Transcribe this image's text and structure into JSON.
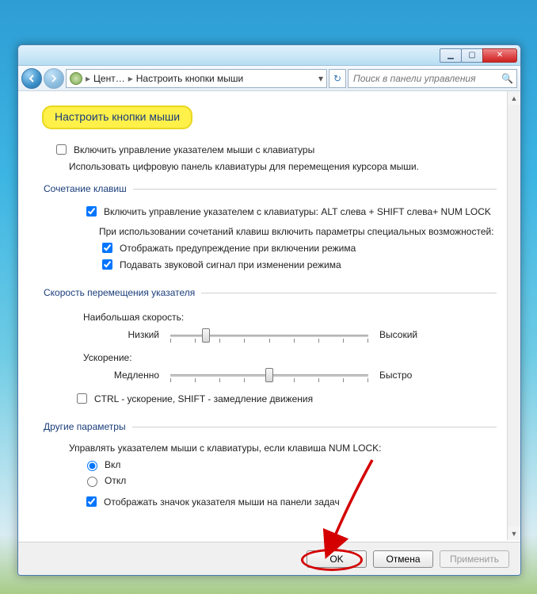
{
  "breadcrumb": {
    "root": "Цент…",
    "current": "Настроить кнопки мыши"
  },
  "search": {
    "placeholder": "Поиск в панели управления"
  },
  "page": {
    "title": "Настроить кнопки мыши",
    "enable_mouse_keys": "Включить управление указателем мыши с клавиатуры",
    "enable_mouse_keys_desc": "Использовать цифровую панель клавиатуры для перемещения курсора мыши."
  },
  "shortcut": {
    "legend": "Сочетание клавиш",
    "enable": "Включить управление указателем с клавиатуры: ALT слева + SHIFT слева+ NUM LOCK",
    "on_use": "При использовании сочетаний клавиш включить параметры специальных возможностей:",
    "warn": "Отображать предупреждение при включении режима",
    "sound": "Подавать звуковой сигнал при изменении режима"
  },
  "speed": {
    "legend": "Скорость перемещения указателя",
    "max_label": "Наибольшая скорость:",
    "low": "Низкий",
    "high": "Высокий",
    "accel_label": "Ускорение:",
    "slow": "Медленно",
    "fast": "Быстро",
    "ctrl_shift": "CTRL - ускорение, SHIFT - замедление движения",
    "speed_value": 18,
    "accel_value": 50
  },
  "other": {
    "legend": "Другие параметры",
    "numlock_label": "Управлять указателем мыши с клавиатуры, если клавиша NUM LOCK:",
    "on": "Вкл",
    "off": "Откл",
    "tray": "Отображать значок указателя мыши на панели задач"
  },
  "buttons": {
    "ok": "OK",
    "cancel": "Отмена",
    "apply": "Применить"
  },
  "checked": {
    "enable_mouse_keys": false,
    "shortcut_enable": true,
    "warn": true,
    "sound": true,
    "ctrl_shift": false,
    "numlock_on": true,
    "tray": true
  }
}
